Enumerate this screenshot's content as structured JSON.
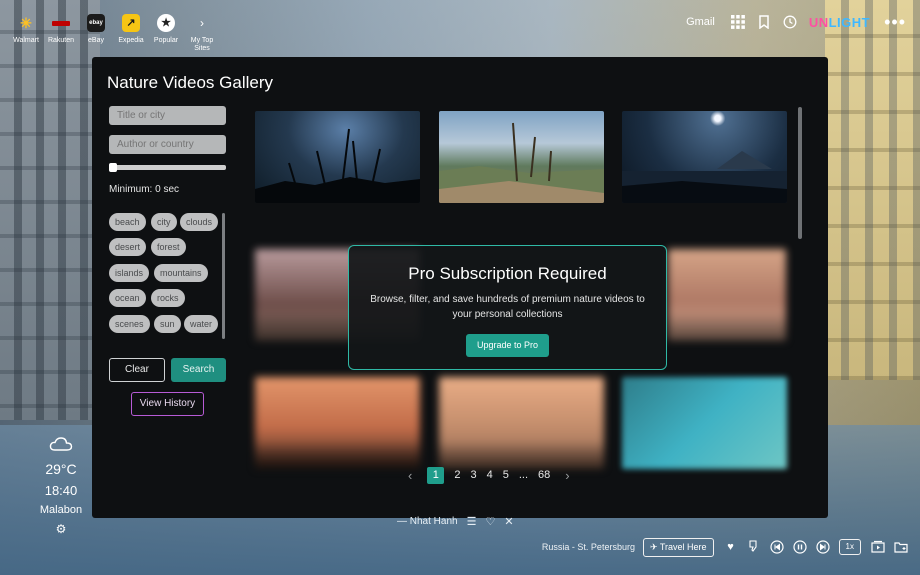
{
  "shortcuts": [
    {
      "label": "Walmart",
      "icon": "walmart-icon",
      "color": "#1a75cf"
    },
    {
      "label": "Rakuten",
      "icon": "rakuten-icon",
      "color": "#bf0000"
    },
    {
      "label": "eBay",
      "icon": "ebay-icon",
      "color": "#1b1b1b",
      "glyph": "ebay"
    },
    {
      "label": "Expedia",
      "icon": "expedia-icon",
      "color": "#f6c514"
    },
    {
      "label": "Popular",
      "icon": "star-icon",
      "color": "#ffffff"
    },
    {
      "label": "My Top Sites",
      "icon": "chevron-right-icon",
      "color": "transparent"
    }
  ],
  "topbar": {
    "gmail": "Gmail",
    "brand_part1": "UN",
    "brand_part2": "LIGHT"
  },
  "modal": {
    "title": "Nature Videos Gallery",
    "title_placeholder": "Title or city",
    "author_placeholder": "Author or country",
    "minimum_label": "Minimum: 0 sec",
    "tags": [
      "beach",
      "city",
      "clouds",
      "desert",
      "forest",
      "islands",
      "mountains",
      "ocean",
      "rocks",
      "scenes",
      "sun",
      "water"
    ],
    "clear_label": "Clear",
    "search_label": "Search",
    "history_label": "View History"
  },
  "pro": {
    "title": "Pro Subscription Required",
    "description": "Browse, filter, and save hundreds of premium nature videos to your personal collections",
    "button": "Upgrade to Pro"
  },
  "pagination": {
    "pages": [
      "1",
      "2",
      "3",
      "4",
      "5",
      "...",
      "68"
    ],
    "current": "1"
  },
  "weather": {
    "temp": "29°C",
    "time": "18:40",
    "city": "Malabon"
  },
  "quote": {
    "author": "— Nhat Hanh"
  },
  "bottom": {
    "location": "Russia - St. Petersburg",
    "travel": "Travel Here",
    "speed": "1x"
  },
  "colors": {
    "accent": "#1f9e8c",
    "history_border": "#b75bd6"
  }
}
